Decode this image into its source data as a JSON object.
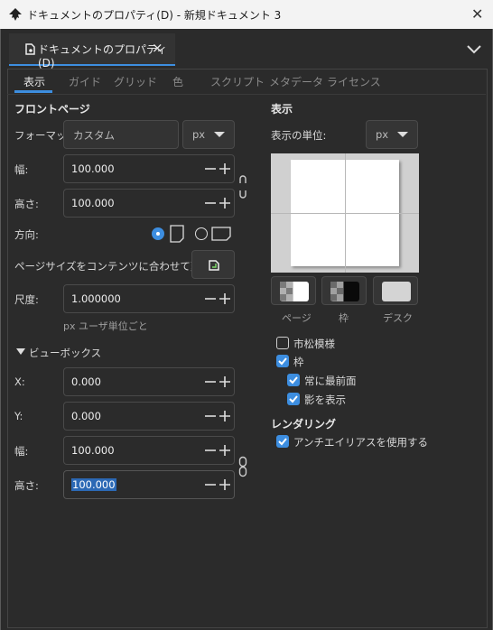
{
  "window": {
    "title": "ドキュメントのプロパティ(D) - 新規ドキュメント 3"
  },
  "dock": {
    "tab_label": "ドキュメントのプロパティ(D)"
  },
  "tabs": [
    "表示",
    "ガイド",
    "グリッド",
    "色",
    "スクリプト",
    "メタデータ",
    "ライセンス"
  ],
  "front_page": {
    "heading": "フロントページ",
    "format_label": "フォーマット:",
    "format_value": "カスタム",
    "format_unit": "px",
    "width_label": "幅:",
    "width_value": "100.000",
    "height_label": "高さ:",
    "height_value": "100.000",
    "orientation_label": "方向:",
    "resize_label": "ページサイズをコンテンツに合わせて変更:",
    "scale_label": "尺度:",
    "scale_value": "1.000000",
    "scale_hint": "px ユーザ単位ごと"
  },
  "viewbox": {
    "heading": "ビューボックス",
    "x_label": "X:",
    "x_value": "0.000",
    "y_label": "Y:",
    "y_value": "0.000",
    "width_label": "幅:",
    "width_value": "100.000",
    "height_label": "高さ:",
    "height_value": "100.000"
  },
  "display": {
    "heading": "表示",
    "unit_label": "表示の単位:",
    "unit_value": "px",
    "swatch_labels": [
      "ページ",
      "枠",
      "デスク"
    ],
    "checkerboard_label": "市松模様",
    "border_label": "枠",
    "always_on_top_label": "常に最前面",
    "show_shadow_label": "影を表示",
    "rendering_heading": "レンダリング",
    "antialias_label": "アンチエイリアスを使用する"
  },
  "colors": {
    "accent": "#3d8ee0",
    "background": "#2b2b2b"
  }
}
